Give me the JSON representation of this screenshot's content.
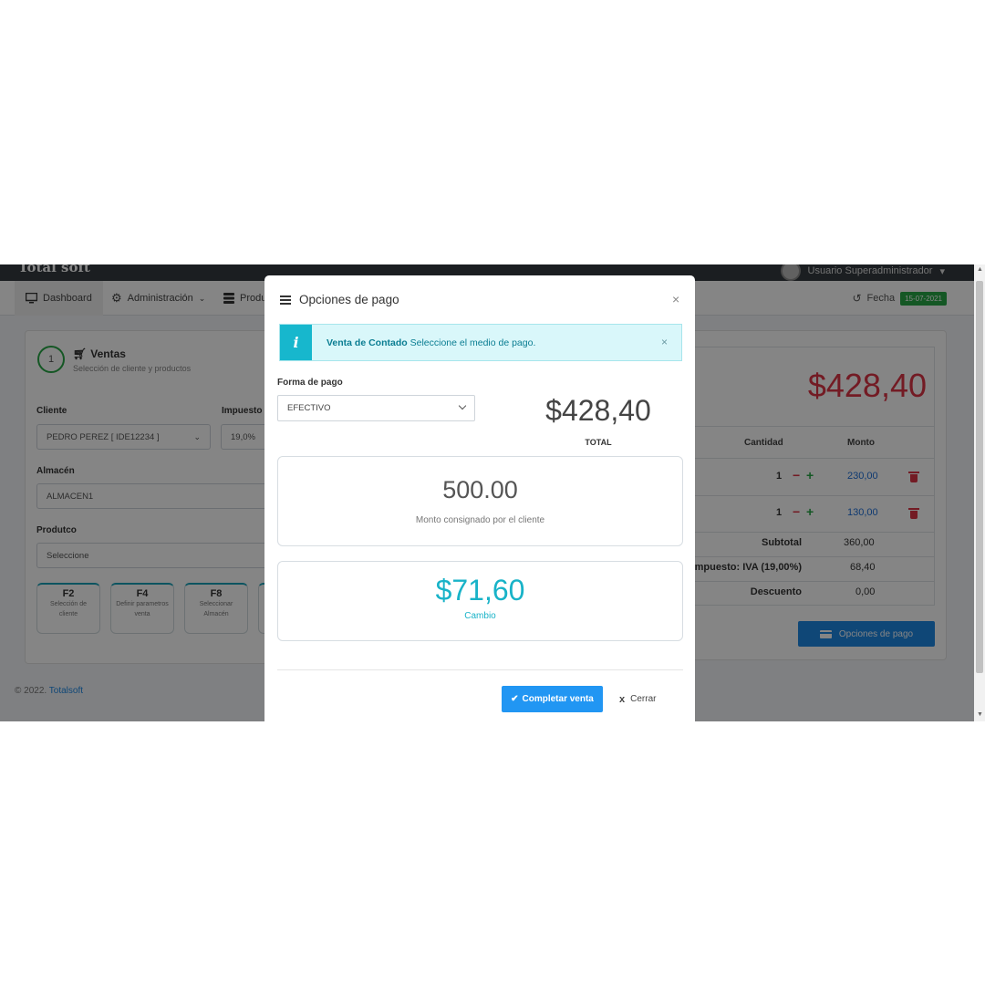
{
  "app": {
    "brand": "Total soft",
    "user": "Usuario Superadministrador"
  },
  "nav": {
    "dashboard": "Dashboard",
    "administracion": "Administración",
    "productos": "Produ",
    "fecha_label": "Fecha",
    "fecha_value": "15-07-2021"
  },
  "left": {
    "step_number": "1",
    "step_title": "Ventas",
    "step_subtitle": "Selección de cliente y productos",
    "cliente_label": "Cliente",
    "cliente_value": "PEDRO PEREZ [ IDE12234 ]",
    "impuesto_label": "Impuesto",
    "impuesto_value": "19,0%",
    "almacen_label": "Almacén",
    "almacen_value": "ALMACEN1",
    "producto_label": "Produtco",
    "producto_value": "Seleccione",
    "fkeys": [
      {
        "key": "F2",
        "desc": "Selección de cliente"
      },
      {
        "key": "F4",
        "desc": "Definir parametros venta"
      },
      {
        "key": "F8",
        "desc": "Seleccionar Almacén"
      }
    ]
  },
  "footer": {
    "prefix": "© 2022.",
    "link": "Totalsoft"
  },
  "right": {
    "total": "$428,40",
    "col_cantidad": "Cantidad",
    "col_monto": "Monto",
    "rows": [
      {
        "qty": "1",
        "amount": "230,00"
      },
      {
        "qty": "1",
        "amount": "130,00"
      }
    ],
    "subtotal_label": "Subtotal",
    "subtotal_value": "360,00",
    "impuesto_label": "Impuesto: IVA (19,00%)",
    "impuesto_value": "68,40",
    "descuento_label": "Descuento",
    "descuento_value": "0,00",
    "opciones_button": "Opciones de pago"
  },
  "modal": {
    "title": "Opciones de pago",
    "alert_bold": "Venta de Contado",
    "alert_text": "Seleccione el medio de pago.",
    "forma_pago_label": "Forma de pago",
    "forma_pago_value": "EFECTIVO",
    "total": "$428,40",
    "total_label": "TOTAL",
    "monto": "500.00",
    "monto_label": "Monto consignado por el cliente",
    "cambio": "$71,60",
    "cambio_label": "Cambio",
    "complete_button": "Completar venta",
    "close_button": "Cerrar"
  },
  "colors": {
    "accent_blue": "#2196f3",
    "total_red": "#dc3545",
    "info_cyan": "#17b7cd",
    "success_green": "#28a745"
  }
}
